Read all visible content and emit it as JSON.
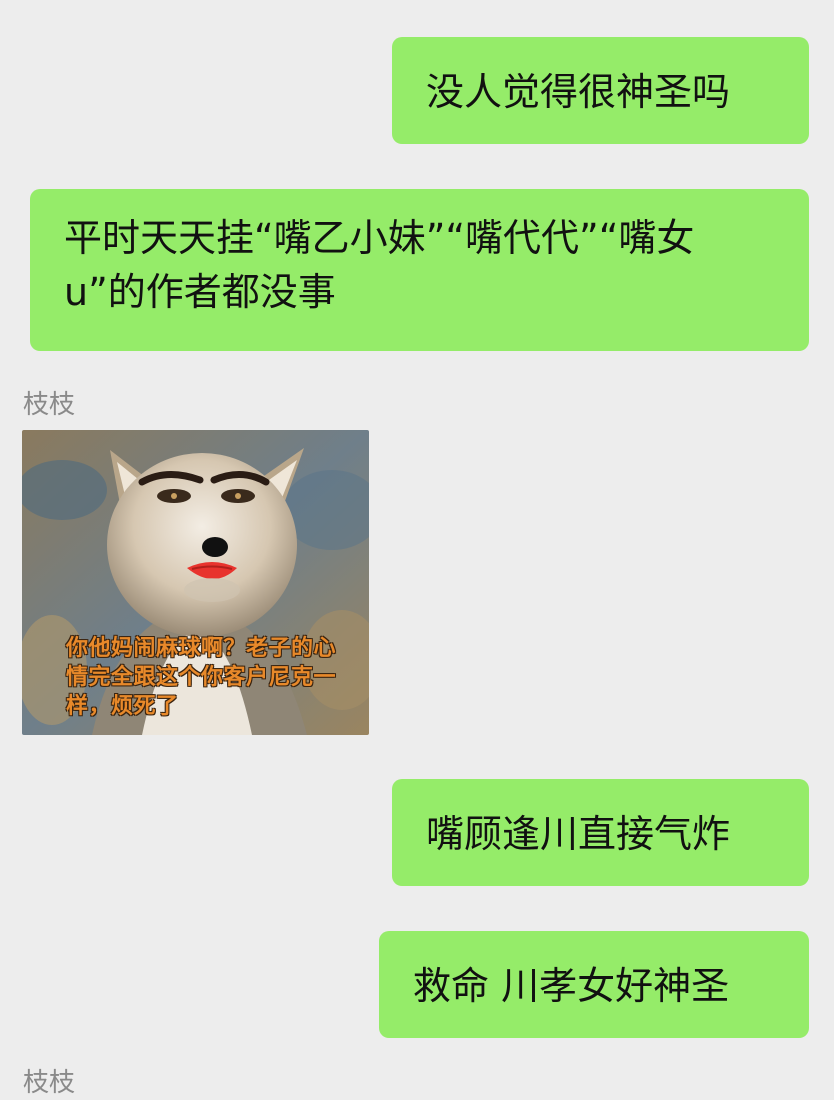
{
  "messages": [
    {
      "side": "right",
      "text": "没人觉得很神圣吗"
    },
    {
      "side": "right",
      "text": "平时天天挂“嘴乙小妹”“嘴代代”“嘴女u”的作者都没事"
    },
    {
      "side": "left",
      "sender": "枝枝",
      "type": "sticker",
      "caption": "你他妈闹麻球啊？老子的心情完全跟这个你客户尼克一样，烦死了"
    },
    {
      "side": "right",
      "text": "嘴顾逢川直接气炸"
    },
    {
      "side": "right",
      "text": "救命 川孝女好神圣"
    }
  ],
  "next_sender": "枝枝",
  "colors": {
    "background": "#ededed",
    "bubble_self": "#95ec69",
    "sender_name": "#8a8a8a"
  },
  "icons": {
    "sticker": "fox-meme-sticker"
  }
}
